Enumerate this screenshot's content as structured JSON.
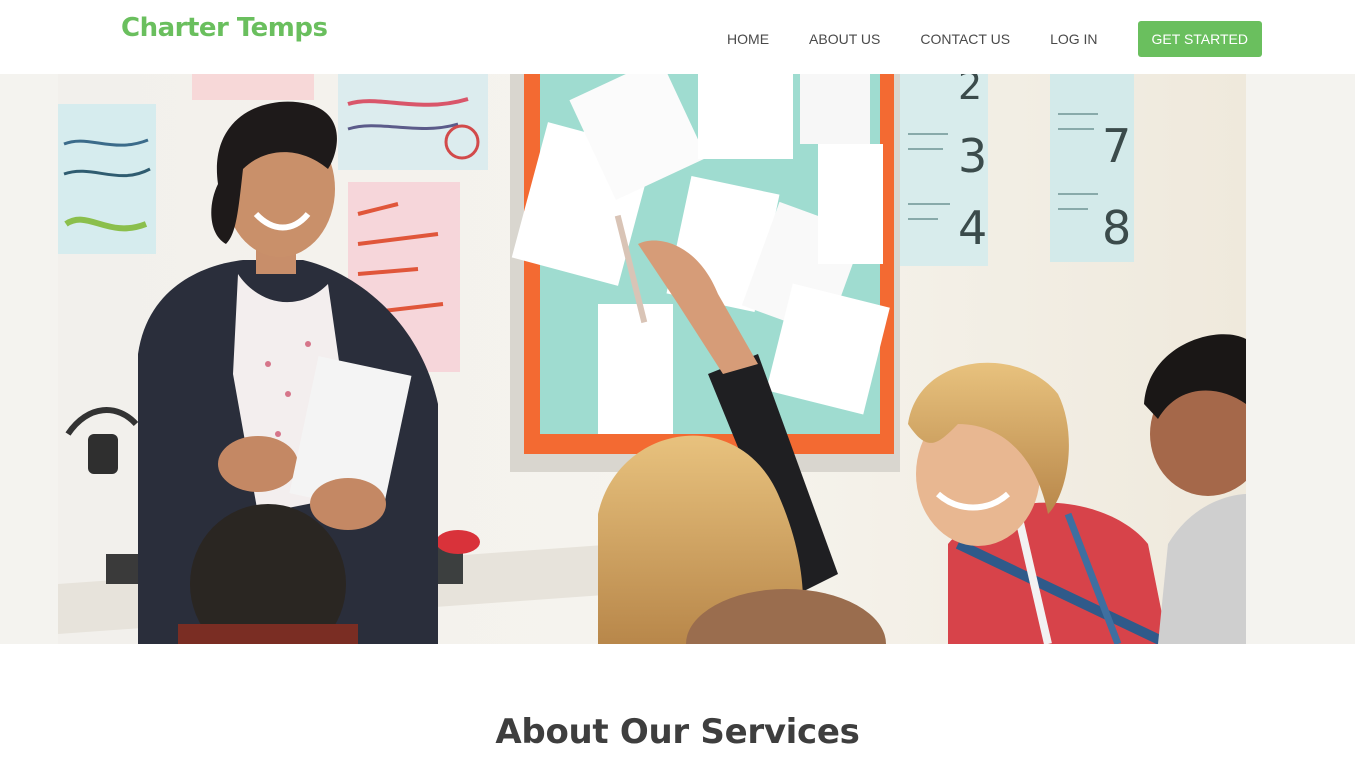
{
  "brand": {
    "name": "Charter Temps",
    "accent_color": "#6abf5e"
  },
  "nav": {
    "home": "HOME",
    "about": "ABOUT US",
    "contact": "CONTACT US",
    "login": "LOG IN",
    "cta": "GET STARTED"
  },
  "hero": {
    "scene": "classroom-teacher-with-students-photo"
  },
  "board": {
    "numbers": [
      "2",
      "3",
      "4",
      "7",
      "8"
    ]
  },
  "section": {
    "title": "About Our Services"
  }
}
